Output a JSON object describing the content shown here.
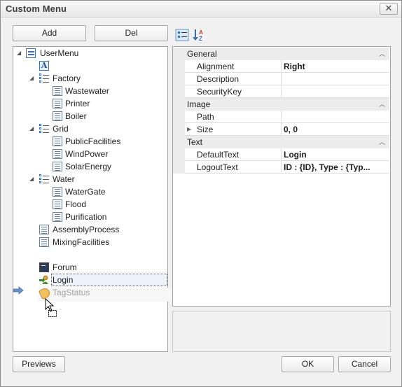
{
  "window": {
    "title": "Custom Menu",
    "close_label": "✕"
  },
  "toolbar": {
    "add_label": "Add",
    "del_label": "Del"
  },
  "tree": {
    "items": [
      {
        "label": "UserMenu"
      },
      {
        "label": ""
      },
      {
        "label": "Factory"
      },
      {
        "label": "Wastewater"
      },
      {
        "label": "Printer"
      },
      {
        "label": "Boiler"
      },
      {
        "label": "Grid"
      },
      {
        "label": "PublicFacilities"
      },
      {
        "label": "WindPower"
      },
      {
        "label": "SolarEnergy"
      },
      {
        "label": "Water"
      },
      {
        "label": "WaterGate"
      },
      {
        "label": "Flood"
      },
      {
        "label": "Purification"
      },
      {
        "label": "AssemblyProcess"
      },
      {
        "label": "MixingFacilities"
      },
      {
        "label": "Forum"
      },
      {
        "label": "Login"
      }
    ],
    "drag_item": {
      "label": "TagStatus"
    }
  },
  "properties": {
    "categories": [
      {
        "label": "General"
      },
      {
        "label": "Image"
      },
      {
        "label": "Text"
      }
    ],
    "rows": [
      {
        "name": "Alignment",
        "value": "Right"
      },
      {
        "name": "Description",
        "value": ""
      },
      {
        "name": "SecurityKey",
        "value": ""
      },
      {
        "name": "Path",
        "value": ""
      },
      {
        "name": "Size",
        "value": "0, 0"
      },
      {
        "name": "DefaultText",
        "value": "Login"
      },
      {
        "name": "LogoutText",
        "value": "ID : {ID}, Type : {Typ..."
      }
    ]
  },
  "footer": {
    "previews_label": "Previews",
    "ok_label": "OK",
    "cancel_label": "Cancel"
  }
}
